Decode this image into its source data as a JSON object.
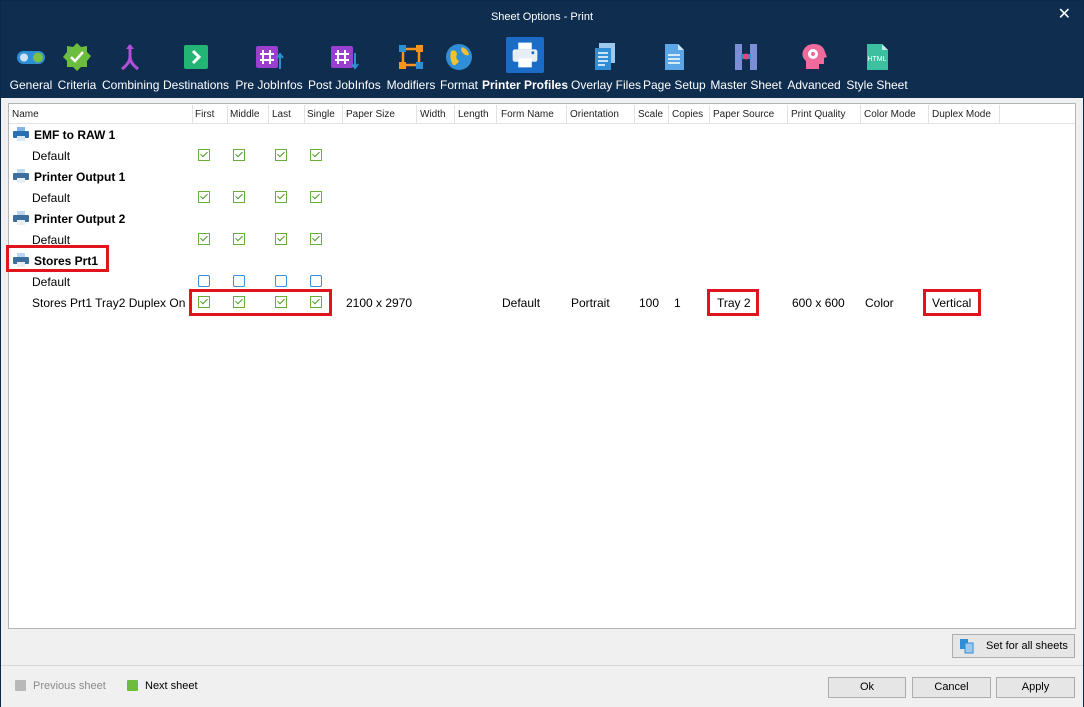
{
  "window": {
    "title": "Sheet Options - Print"
  },
  "toolbar": {
    "items": [
      {
        "label": "General"
      },
      {
        "label": "Criteria"
      },
      {
        "label": "Combining"
      },
      {
        "label": "Destinations"
      },
      {
        "label": "Pre JobInfos"
      },
      {
        "label": "Post JobInfos"
      },
      {
        "label": "Modifiers"
      },
      {
        "label": "Format"
      },
      {
        "label": "Printer Profiles"
      },
      {
        "label": "Overlay Files"
      },
      {
        "label": "Page Setup"
      },
      {
        "label": "Master Sheet"
      },
      {
        "label": "Advanced"
      },
      {
        "label": "Style Sheet"
      }
    ],
    "active": "Printer Profiles",
    "style_sheet_icon_text": "HTML"
  },
  "columns": [
    "Name",
    "First",
    "Middle",
    "Last",
    "Single",
    "Paper Size",
    "Width",
    "Length",
    "Form Name",
    "Orientation",
    "Scale",
    "Copies",
    "Paper Source",
    "Print Quality",
    "Color Mode",
    "Duplex Mode"
  ],
  "groups": [
    {
      "name": "EMF to RAW 1",
      "rows": [
        {
          "name": "Default",
          "checks": [
            true,
            true,
            true,
            true
          ]
        }
      ]
    },
    {
      "name": "Printer Output 1",
      "rows": [
        {
          "name": "Default",
          "checks": [
            true,
            true,
            true,
            true
          ]
        }
      ]
    },
    {
      "name": "Printer Output 2",
      "rows": [
        {
          "name": "Default",
          "checks": [
            true,
            true,
            true,
            true
          ]
        }
      ]
    },
    {
      "name": "Stores Prt1",
      "rows": [
        {
          "name": "Default",
          "checks": [
            false,
            false,
            false,
            false
          ]
        },
        {
          "name": "Stores Prt1 Tray2 Duplex On",
          "checks": [
            true,
            true,
            true,
            true
          ],
          "paper_size": "2100 x 2970",
          "width": "",
          "length": "",
          "form_name": "Default",
          "orientation": "Portrait",
          "scale": "100",
          "copies": "1",
          "paper_source": "Tray 2",
          "print_quality": "600 x 600",
          "color_mode": "Color",
          "duplex_mode": "Vertical"
        }
      ]
    }
  ],
  "footer": {
    "set_all_label": "Set for all sheets",
    "previous_label": "Previous sheet",
    "next_label": "Next sheet",
    "ok_label": "Ok",
    "cancel_label": "Cancel",
    "apply_label": "Apply"
  },
  "colors": {
    "title_bar": "#0e2d4f",
    "highlight": "#e0141c",
    "check_green": "#69ad3a",
    "checkbox_blue": "#3a8fd8",
    "active_tab": "#1a6cc7"
  }
}
